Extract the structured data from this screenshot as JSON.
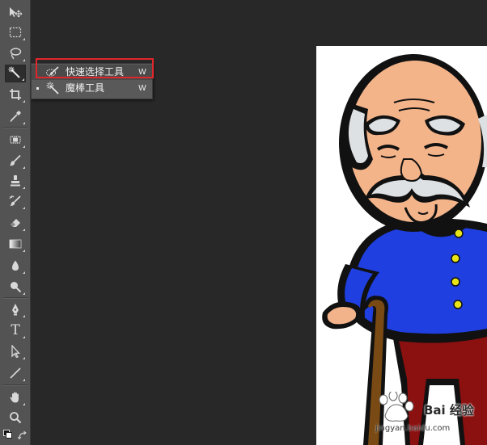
{
  "toolbar": {
    "tools": [
      {
        "name": "move-tool",
        "icon": "move-icon"
      },
      {
        "name": "rectangular-marquee-tool",
        "icon": "marquee-icon"
      },
      {
        "name": "lasso-tool",
        "icon": "lasso-icon"
      },
      {
        "name": "quick-selection-tool",
        "icon": "magic-wand-icon",
        "active": true
      },
      {
        "name": "crop-tool",
        "icon": "crop-icon"
      },
      {
        "name": "eyedropper-tool",
        "icon": "eyedropper-icon"
      },
      {
        "name": "spot-healing-tool",
        "icon": "bandage-icon"
      },
      {
        "name": "brush-tool",
        "icon": "brush-icon"
      },
      {
        "name": "clone-stamp-tool",
        "icon": "stamp-icon"
      },
      {
        "name": "history-brush-tool",
        "icon": "history-brush-icon"
      },
      {
        "name": "eraser-tool",
        "icon": "eraser-icon"
      },
      {
        "name": "gradient-tool",
        "icon": "gradient-icon"
      },
      {
        "name": "blur-tool",
        "icon": "drop-icon"
      },
      {
        "name": "dodge-tool",
        "icon": "dodge-icon"
      },
      {
        "name": "pen-tool",
        "icon": "pen-icon"
      },
      {
        "name": "type-tool",
        "icon": "type-icon",
        "glyph": "T"
      },
      {
        "name": "path-selection-tool",
        "icon": "arrow-icon"
      },
      {
        "name": "line-tool",
        "icon": "line-icon"
      },
      {
        "name": "hand-tool",
        "icon": "hand-icon"
      },
      {
        "name": "zoom-tool",
        "icon": "zoom-icon"
      }
    ]
  },
  "flyout": {
    "items": [
      {
        "label": "快速选择工具",
        "shortcut": "W",
        "icon": "quick-selection-icon",
        "selected": true
      },
      {
        "label": "魔棒工具",
        "shortcut": "W",
        "icon": "magic-wand-icon",
        "selected": false
      }
    ]
  },
  "highlight_color": "#e0262b",
  "canvas": {
    "image": "cartoon-old-man-with-cane"
  },
  "watermark": {
    "brand": "Bai 经验",
    "url": "jingyan.baidu.com"
  }
}
